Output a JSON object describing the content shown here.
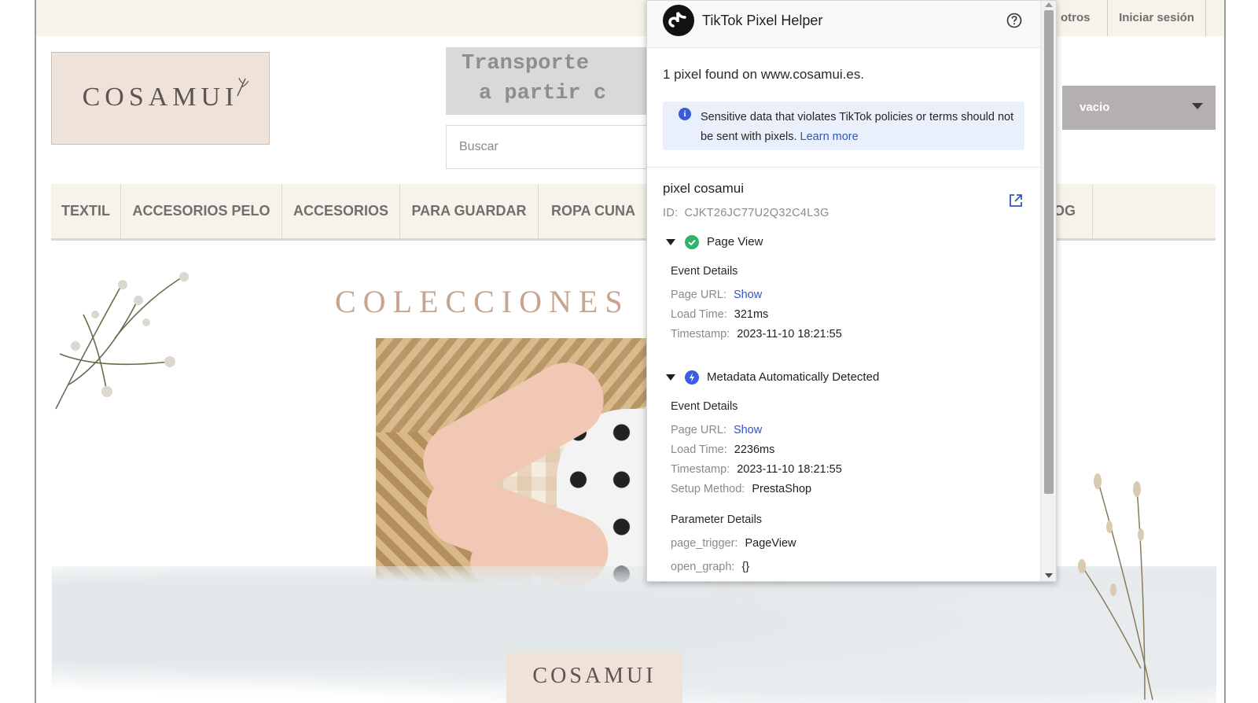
{
  "site": {
    "top_links": {
      "otros": "otros",
      "login": "Iniciar sesión"
    },
    "logo_text": "COSAMUI",
    "banner": {
      "line1": "Transporte",
      "line2": "a partir c"
    },
    "search_placeholder": "Buscar",
    "cart_label": "vacio",
    "nav": [
      "TEXTIL",
      "ACCESORIOS PELO",
      "ACCESORIOS",
      "PARA GUARDAR",
      "ROPA CUNA",
      "OG"
    ],
    "hero_title": "COLECCIONES",
    "bottom_logo_text": "COSAMUI"
  },
  "helper": {
    "title": "TikTok Pixel Helper",
    "found_text": "1 pixel found on www.cosamui.es.",
    "notice": {
      "text": "Sensitive data that violates TikTok policies or terms should not be sent with pixels.",
      "link": "Learn more"
    },
    "pixel": {
      "name": "pixel cosamui",
      "id_label": "ID:",
      "id": "CJKT26JC77U2Q32C4L3G"
    },
    "events": [
      {
        "name": "Page View",
        "status": "success",
        "section_title": "Event Details",
        "rows": [
          {
            "k": "Page URL:",
            "v": "Show",
            "link": true
          },
          {
            "k": "Load Time:",
            "v": "321ms"
          },
          {
            "k": "Timestamp:",
            "v": "2023-11-10 18:21:55"
          }
        ]
      },
      {
        "name": "Metadata Automatically Detected",
        "status": "auto",
        "section_title": "Event Details",
        "rows": [
          {
            "k": "Page URL:",
            "v": "Show",
            "link": true
          },
          {
            "k": "Load Time:",
            "v": "2236ms"
          },
          {
            "k": "Timestamp:",
            "v": "2023-11-10 18:21:55"
          },
          {
            "k": "Setup Method:",
            "v": "PrestaShop"
          }
        ],
        "param_title": "Parameter Details",
        "params": [
          {
            "k": "page_trigger:",
            "v": "PageView"
          },
          {
            "k": "open_graph:",
            "v": "{}"
          }
        ]
      }
    ]
  },
  "colors": {
    "tiktok_blue": "#2f56c5",
    "success_green": "#2fb36c",
    "site_beige": "#f6f3ea",
    "logo_pink": "#efe2d8"
  }
}
